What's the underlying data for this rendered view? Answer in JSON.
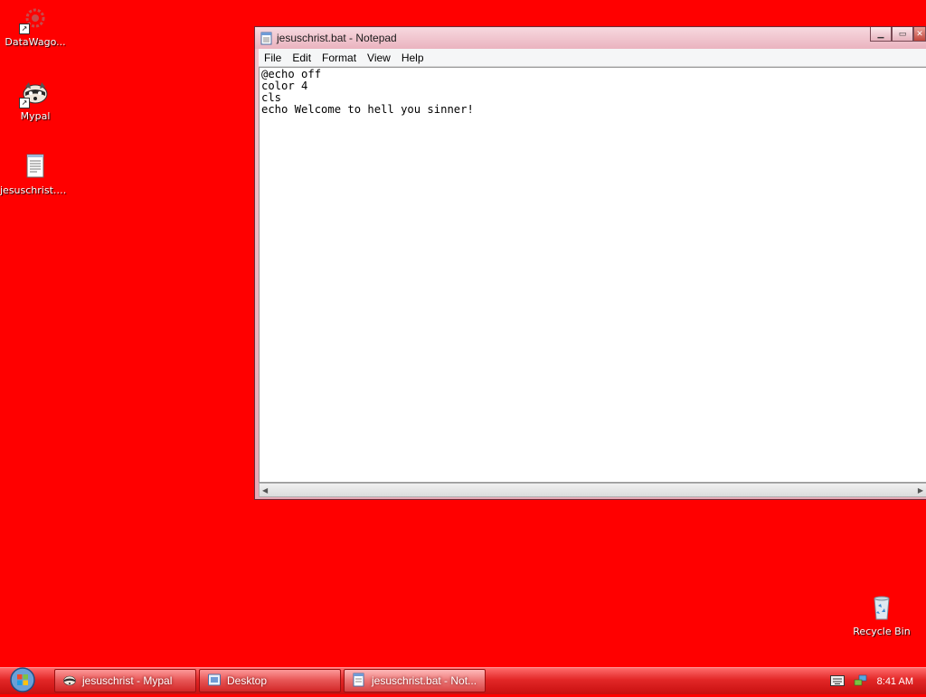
{
  "desktop": {
    "background_color": "#ff0000",
    "icons": [
      {
        "label": "DataWago...",
        "icon": "datawagon-icon",
        "shortcut": true
      },
      {
        "label": "Mypal",
        "icon": "mypal-raccoon-icon",
        "shortcut": true
      },
      {
        "label": "jesuschrist.bat",
        "icon": "text-file-icon",
        "shortcut": false
      },
      {
        "label": "Recycle Bin",
        "icon": "recycle-bin-icon",
        "shortcut": false
      }
    ]
  },
  "notepad": {
    "title": "jesuschrist.bat - Notepad",
    "menu": [
      "File",
      "Edit",
      "Format",
      "View",
      "Help"
    ],
    "content": "@echo off\ncolor 4\ncls\necho Welcome to hell you sinner!"
  },
  "taskbar": {
    "accent_color": "#d41818",
    "buttons": [
      {
        "label": "jesuschrist - Mypal",
        "icon": "mypal-raccoon-icon",
        "active": false
      },
      {
        "label": "Desktop",
        "icon": "folder-icon",
        "active": false
      },
      {
        "label": "jesuschrist.bat - Not...",
        "icon": "notepad-icon",
        "active": true
      }
    ],
    "tray": {
      "icons": [
        "keyboard-icon",
        "network-icon"
      ],
      "time": "8:41 AM"
    }
  }
}
